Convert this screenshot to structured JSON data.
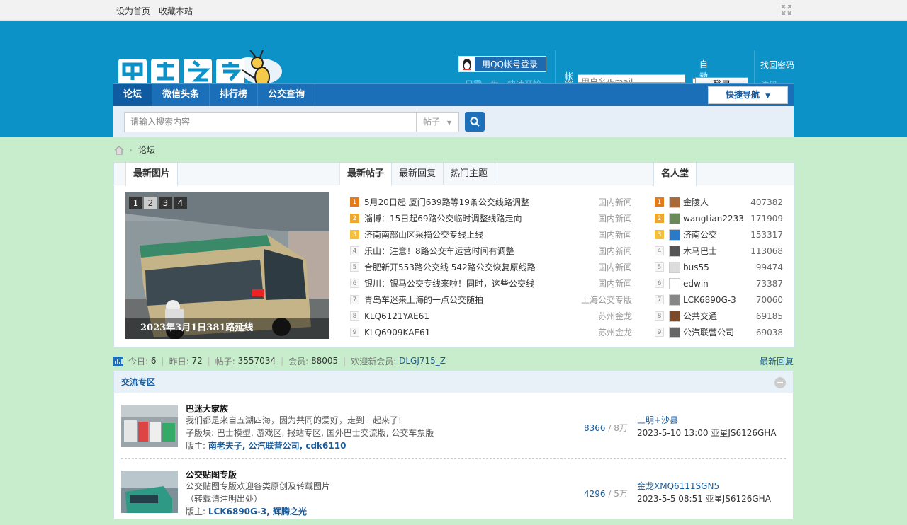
{
  "topbar": {
    "set_home": "设为首页",
    "bookmark": "收藏本站"
  },
  "header": {
    "logo_alt": "巴士之家",
    "qq_login": "用QQ帐号登录",
    "qq_hint": "只需一步，快速开始",
    "account_label": "帐号",
    "account_placeholder": "用户名/Email",
    "auto_login": "自动登录",
    "find_password": "找回密码",
    "password_label": "密码",
    "login_button": "登录",
    "register": "注册"
  },
  "nav": {
    "items": [
      "论坛",
      "微信头条",
      "排行榜",
      "公交查询"
    ],
    "quick_nav": "快捷导航"
  },
  "search": {
    "placeholder": "请输入搜索内容",
    "type": "帖子"
  },
  "breadcrumb": {
    "current": "论坛"
  },
  "portal": {
    "images_tab": "最新图片",
    "slide_numbers": [
      "1",
      "2",
      "3",
      "4"
    ],
    "slide_current": "2",
    "slide_caption": "2023年3月1日381路延线",
    "post_tabs": [
      "最新帖子",
      "最新回复",
      "热门主题"
    ],
    "posts": [
      {
        "rank": "1",
        "title": "5月20日起 厦门639路等19条公交线路调整",
        "category": "国内新闻"
      },
      {
        "rank": "2",
        "title": "淄博：15日起69路公交临时调整线路走向",
        "category": "国内新闻"
      },
      {
        "rank": "3",
        "title": "济南南部山区采摘公交专线上线",
        "category": "国内新闻"
      },
      {
        "rank": "4",
        "title": "乐山：注意！8路公交车运营时间有调整",
        "category": "国内新闻"
      },
      {
        "rank": "5",
        "title": "合肥新开553路公交线 542路公交恢复原线路",
        "category": "国内新闻"
      },
      {
        "rank": "6",
        "title": "银川：银马公交专线来啦！同时，这些公交线",
        "category": "国内新闻"
      },
      {
        "rank": "7",
        "title": "青岛车迷来上海的一点公交随拍",
        "category": "上海公交专版"
      },
      {
        "rank": "8",
        "title": "KLQ6121YAE61",
        "category": "苏州金龙"
      },
      {
        "rank": "9",
        "title": "KLQ6909KAE61",
        "category": "苏州金龙"
      }
    ],
    "fame_tab": "名人堂",
    "members": [
      {
        "rank": "1",
        "name": "金陵人",
        "score": "407382"
      },
      {
        "rank": "2",
        "name": "wangtian2233",
        "score": "171909"
      },
      {
        "rank": "3",
        "name": "济南公交",
        "score": "153317"
      },
      {
        "rank": "4",
        "name": "木马巴士",
        "score": "113068"
      },
      {
        "rank": "5",
        "name": "bus55",
        "score": "99474"
      },
      {
        "rank": "6",
        "name": "edwin",
        "score": "73387"
      },
      {
        "rank": "7",
        "name": "LCK6890G-3",
        "score": "70060"
      },
      {
        "rank": "8",
        "name": "公共交通",
        "score": "69185"
      },
      {
        "rank": "9",
        "name": "公汽联营公司",
        "score": "69038"
      }
    ]
  },
  "stats": {
    "today_label": "今日:",
    "today": "6",
    "yesterday_label": "昨日:",
    "yesterday": "72",
    "posts_label": "帖子:",
    "posts": "3557034",
    "members_label": "会员:",
    "members": "88005",
    "welcome_label": "欢迎新会员:",
    "new_member": "DLGJ715_Z",
    "latest_reply": "最新回复"
  },
  "section": {
    "title": "交流专区",
    "forums": [
      {
        "name": "巴迷大家族",
        "desc": "我们都是来自五湖四海，因为共同的爱好，走到一起来了!",
        "sub_label": "子版块:",
        "subs": "巴士模型, 游戏区, 报站专区, 国外巴士交流版, 公交车票版",
        "mod_label": "版主:",
        "mods": "南老夫子, 公汽联营公司, cdk6110",
        "threads": "8366",
        "posts": "8万",
        "last_title": "三明+沙县",
        "last_info": "2023-5-10 13:00 亚星JS6126GHA"
      },
      {
        "name": "公交贴图专版",
        "desc": "公交贴图专版欢迎各类原创及转载图片",
        "desc2": "（转载请注明出处）",
        "mod_label": "版主:",
        "mods": "LCK6890G-3, 辉腾之光",
        "threads": "4296",
        "posts": "5万",
        "last_title": "金龙XMQ6111SGN5",
        "last_info": "2023-5-5 08:51 亚星JS6126GHA"
      }
    ]
  },
  "colors": {
    "header_blue": "#0d92c8",
    "nav_blue": "#1b6fb8",
    "page_bg": "#c7edcc",
    "link_blue": "#1b5c9a"
  }
}
